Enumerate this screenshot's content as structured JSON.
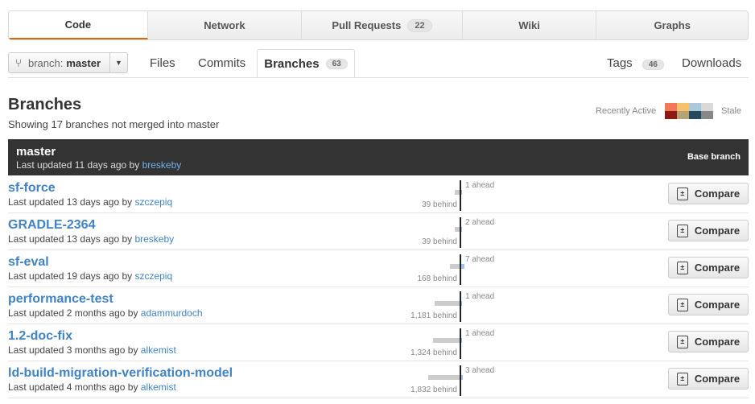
{
  "topnav": [
    {
      "label": "Code",
      "selected": true
    },
    {
      "label": "Network"
    },
    {
      "label": "Pull Requests",
      "count": "22"
    },
    {
      "label": "Wiki"
    },
    {
      "label": "Graphs"
    }
  ],
  "branch_selector": {
    "label": "branch:",
    "value": "master",
    "icon": "branch-icon"
  },
  "subnav": {
    "files": "Files",
    "commits": "Commits",
    "branches": "Branches",
    "branches_count": "63",
    "tags": "Tags",
    "tags_count": "46",
    "downloads": "Downloads"
  },
  "heading": {
    "title": "Branches",
    "subtitle": "Showing 17 branches not merged into master",
    "legend_recent": "Recently Active",
    "legend_stale": "Stale",
    "legend_colors": [
      "#f2775b",
      "#f5c26b",
      "#acc9d9",
      "#d9d9d9",
      "#8b1a14",
      "#b5a374",
      "#254a5c",
      "#888888"
    ]
  },
  "master": {
    "name": "master",
    "updated": "Last updated 11 days ago by ",
    "author": "breskeby",
    "base_label": "Base branch"
  },
  "compare_label": "Compare",
  "branches": [
    {
      "name": "sf-force",
      "updated": "Last updated 13 days ago by ",
      "author": "szczepiq",
      "ahead": "1 ahead",
      "behind": "39 behind",
      "ahead_n": 1,
      "behind_n": 39
    },
    {
      "name": "GRADLE-2364",
      "updated": "Last updated 13 days ago by ",
      "author": "breskeby",
      "ahead": "2 ahead",
      "behind": "39 behind",
      "ahead_n": 2,
      "behind_n": 39
    },
    {
      "name": "sf-eval",
      "updated": "Last updated 19 days ago by ",
      "author": "szczepiq",
      "ahead": "7 ahead",
      "behind": "168 behind",
      "ahead_n": 7,
      "behind_n": 168
    },
    {
      "name": "performance-test",
      "updated": "Last updated 2 months ago by ",
      "author": "adammurdoch",
      "ahead": "1 ahead",
      "behind": "1,181 behind",
      "ahead_n": 1,
      "behind_n": 1181
    },
    {
      "name": "1.2-doc-fix",
      "updated": "Last updated 3 months ago by ",
      "author": "alkemist",
      "ahead": "1 ahead",
      "behind": "1,324 behind",
      "ahead_n": 1,
      "behind_n": 1324
    },
    {
      "name": "ld-build-migration-verification-model",
      "updated": "Last updated 4 months ago by ",
      "author": "alkemist",
      "ahead": "3 ahead",
      "behind": "1,832 behind",
      "ahead_n": 3,
      "behind_n": 1832
    }
  ]
}
